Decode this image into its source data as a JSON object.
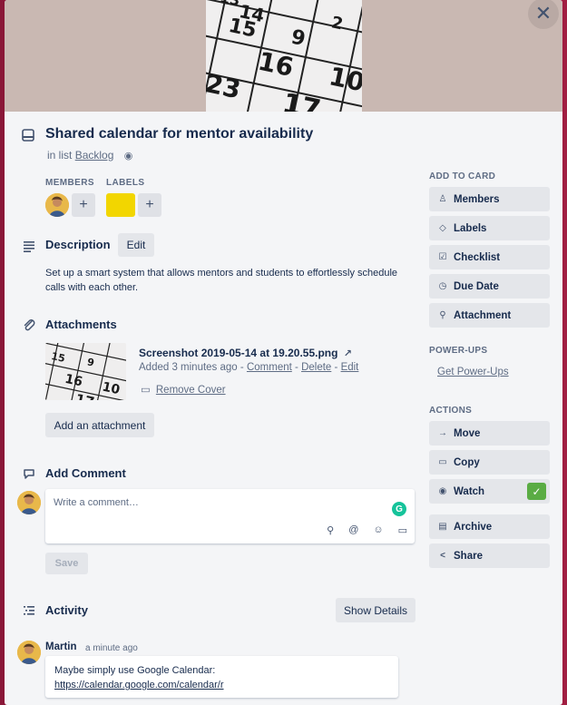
{
  "card": {
    "title": "Shared calendar for mentor availability",
    "in_list_prefix": "in list",
    "list_name": "Backlog",
    "close_icon": "close-icon",
    "close_glyph": "✕"
  },
  "members": {
    "label": "MEMBERS",
    "add": "+"
  },
  "labels": {
    "label": "LABELS",
    "add": "+",
    "label_color": "#f2d600"
  },
  "description": {
    "title": "Description",
    "edit_label": "Edit",
    "text": "Set up a smart system that allows mentors and students to effortlessly schedule calls with each other."
  },
  "attachments": {
    "title": "Attachments",
    "file_name": "Screenshot 2019-05-14 at 19.20.55.png",
    "added": "Added 3 minutes ago",
    "sep": "-",
    "comment_link": "Comment",
    "delete_link": "Delete",
    "edit_link": "Edit",
    "remove_cover": "Remove Cover",
    "add_button": "Add an attachment"
  },
  "comment": {
    "title": "Add Comment",
    "placeholder": "Write a comment…",
    "save_label": "Save",
    "grammarly": "G"
  },
  "activity": {
    "title": "Activity",
    "show_details": "Show Details",
    "author": "Martin",
    "time": "a minute ago",
    "text": "Maybe simply use Google Calendar:",
    "link": "https://calendar.google.com/calendar/r"
  },
  "sidebar": {
    "add_to_card": "ADD TO CARD",
    "members": "Members",
    "labels": "Labels",
    "checklist": "Checklist",
    "due_date": "Due Date",
    "attachment": "Attachment",
    "power_ups": "POWER-UPS",
    "get_power_ups": "Get Power-Ups",
    "actions": "ACTIONS",
    "move": "Move",
    "copy": "Copy",
    "watch": "Watch",
    "archive": "Archive",
    "share": "Share"
  },
  "colors": {
    "accent_green": "#5aac44",
    "grammarly": "#15c39a"
  }
}
